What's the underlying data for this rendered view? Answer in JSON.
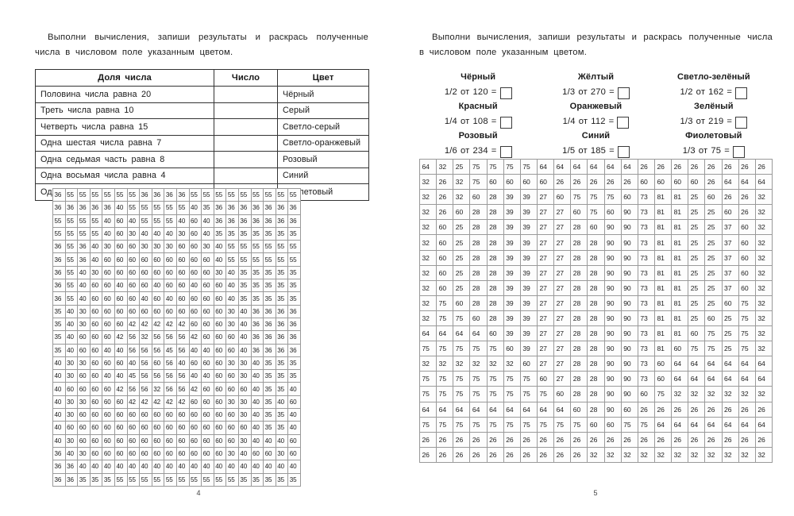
{
  "spread": {
    "left_page": {
      "page_number": "4",
      "instruction_line1": "Выполни вычисления, запиши результаты и раскрась полученные числа",
      "instruction_line2": "в числовом поле указанным цветом.",
      "table": {
        "headers": [
          "Доля числа",
          "Число",
          "Цвет"
        ],
        "rows": [
          {
            "dolya": "Половина числа равна 20",
            "chislo": "",
            "cvet": "Чёрный"
          },
          {
            "dolya": "Треть числа равна 10",
            "chislo": "",
            "cvet": "Серый"
          },
          {
            "dolya": "Четверть числа равна 15",
            "chislo": "",
            "cvet": "Светло-серый"
          },
          {
            "dolya": "Одна шестая числа равна 7",
            "chislo": "",
            "cvet": "Светло-оранжевый"
          },
          {
            "dolya": "Одна седьмая часть равна 8",
            "chislo": "",
            "cvet": "Розовый"
          },
          {
            "dolya": "Одна восьмая числа равна 4",
            "chislo": "",
            "cvet": "Синий"
          },
          {
            "dolya": "Одна пятая числа равна 9",
            "chislo": "",
            "cvet": "Фиолетовый"
          }
        ]
      },
      "number_grid": {
        "columns": 20,
        "rows": [
          [
            36,
            55,
            55,
            55,
            55,
            55,
            55,
            36,
            36,
            36,
            36,
            55,
            55,
            55,
            55,
            55,
            55,
            55,
            55,
            55
          ],
          [
            36,
            36,
            36,
            36,
            36,
            40,
            55,
            55,
            55,
            55,
            55,
            40,
            35,
            36,
            36,
            36,
            36,
            36,
            36,
            36
          ],
          [
            55,
            55,
            55,
            55,
            40,
            60,
            40,
            55,
            55,
            55,
            40,
            60,
            40,
            36,
            36,
            36,
            36,
            36,
            36,
            36
          ],
          [
            55,
            55,
            55,
            55,
            40,
            60,
            30,
            40,
            40,
            40,
            30,
            60,
            40,
            35,
            35,
            35,
            35,
            35,
            35,
            35
          ],
          [
            36,
            55,
            36,
            40,
            30,
            60,
            60,
            30,
            30,
            30,
            60,
            60,
            30,
            40,
            55,
            55,
            55,
            55,
            55,
            55
          ],
          [
            36,
            55,
            36,
            40,
            60,
            60,
            60,
            60,
            60,
            60,
            60,
            60,
            60,
            40,
            55,
            55,
            55,
            55,
            55,
            55
          ],
          [
            36,
            55,
            40,
            30,
            60,
            60,
            60,
            60,
            60,
            60,
            60,
            60,
            60,
            30,
            40,
            35,
            35,
            35,
            35,
            35
          ],
          [
            36,
            55,
            40,
            60,
            60,
            40,
            60,
            60,
            40,
            60,
            60,
            40,
            60,
            60,
            40,
            35,
            35,
            35,
            35,
            35
          ],
          [
            36,
            55,
            40,
            60,
            60,
            60,
            60,
            40,
            60,
            40,
            60,
            60,
            60,
            60,
            40,
            35,
            35,
            35,
            35,
            35
          ],
          [
            35,
            40,
            30,
            60,
            60,
            60,
            60,
            60,
            60,
            60,
            60,
            60,
            60,
            60,
            30,
            40,
            36,
            36,
            36,
            36
          ],
          [
            35,
            40,
            30,
            60,
            60,
            60,
            42,
            42,
            42,
            42,
            42,
            60,
            60,
            60,
            30,
            40,
            36,
            36,
            36,
            36
          ],
          [
            35,
            40,
            60,
            60,
            60,
            42,
            56,
            32,
            56,
            56,
            56,
            42,
            60,
            60,
            60,
            40,
            36,
            36,
            36,
            36
          ],
          [
            35,
            40,
            60,
            60,
            40,
            40,
            56,
            56,
            56,
            45,
            56,
            40,
            40,
            60,
            60,
            40,
            36,
            36,
            36,
            36
          ],
          [
            40,
            30,
            30,
            60,
            60,
            60,
            40,
            56,
            60,
            56,
            40,
            60,
            60,
            60,
            30,
            30,
            40,
            35,
            35,
            35
          ],
          [
            40,
            30,
            60,
            60,
            40,
            40,
            45,
            56,
            56,
            56,
            56,
            40,
            40,
            60,
            60,
            30,
            40,
            35,
            35,
            35
          ],
          [
            40,
            60,
            60,
            60,
            60,
            42,
            56,
            56,
            32,
            56,
            56,
            42,
            60,
            60,
            60,
            60,
            40,
            35,
            35,
            40
          ],
          [
            40,
            30,
            30,
            60,
            60,
            60,
            42,
            42,
            42,
            42,
            42,
            60,
            60,
            60,
            30,
            30,
            40,
            35,
            40,
            60
          ],
          [
            40,
            30,
            60,
            60,
            60,
            60,
            60,
            60,
            60,
            60,
            60,
            60,
            60,
            60,
            60,
            30,
            40,
            35,
            35,
            40
          ],
          [
            40,
            60,
            60,
            60,
            60,
            60,
            60,
            60,
            60,
            60,
            60,
            60,
            60,
            60,
            60,
            60,
            40,
            35,
            35,
            40
          ],
          [
            40,
            30,
            60,
            60,
            60,
            60,
            60,
            60,
            60,
            60,
            60,
            60,
            60,
            60,
            60,
            30,
            40,
            40,
            40,
            60
          ],
          [
            36,
            40,
            30,
            60,
            60,
            60,
            60,
            60,
            60,
            60,
            60,
            60,
            60,
            60,
            30,
            40,
            60,
            60,
            30,
            60
          ],
          [
            36,
            36,
            40,
            40,
            40,
            40,
            40,
            40,
            40,
            40,
            40,
            40,
            40,
            40,
            40,
            40,
            40,
            40,
            40,
            40
          ],
          [
            36,
            36,
            35,
            35,
            35,
            55,
            55,
            55,
            55,
            55,
            55,
            55,
            55,
            55,
            55,
            35,
            35,
            35,
            35,
            35
          ]
        ]
      }
    },
    "right_page": {
      "page_number": "5",
      "instruction_line1": "Выполни вычисления, запиши результаты и раскрась полученные числа",
      "instruction_line2": "в числовом поле указанным цветом.",
      "exercises": [
        [
          {
            "color": "Чёрный",
            "fraction": "1/2",
            "of": "от",
            "number": "120",
            "equals": "=",
            "answer": ""
          },
          {
            "color": "Жёлтый",
            "fraction": "1/3",
            "of": "от",
            "number": "270",
            "equals": "=",
            "answer": ""
          },
          {
            "color": "Светло-зелёный",
            "fraction": "1/2",
            "of": "от",
            "number": "162",
            "equals": "=",
            "answer": ""
          }
        ],
        [
          {
            "color": "Красный",
            "fraction": "1/4",
            "of": "от",
            "number": "108",
            "equals": "=",
            "answer": ""
          },
          {
            "color": "Оранжевый",
            "fraction": "1/4",
            "of": "от",
            "number": "112",
            "equals": "=",
            "answer": ""
          },
          {
            "color": "Зелёный",
            "fraction": "1/3",
            "of": "от",
            "number": "219",
            "equals": "=",
            "answer": ""
          }
        ],
        [
          {
            "color": "Розовый",
            "fraction": "1/6",
            "of": "от",
            "number": "234",
            "equals": "=",
            "answer": ""
          },
          {
            "color": "Синий",
            "fraction": "1/5",
            "of": "от",
            "number": "185",
            "equals": "=",
            "answer": ""
          },
          {
            "color": "Фиолетовый",
            "fraction": "1/3",
            "of": "от",
            "number": "75",
            "equals": "=",
            "answer": ""
          }
        ]
      ],
      "number_grid": {
        "columns": 21,
        "rows": [
          [
            64,
            32,
            25,
            75,
            75,
            75,
            75,
            64,
            64,
            64,
            64,
            64,
            64,
            26,
            26,
            26,
            26,
            26,
            26,
            26,
            26
          ],
          [
            32,
            26,
            32,
            75,
            60,
            60,
            60,
            60,
            26,
            26,
            26,
            26,
            26,
            60,
            60,
            60,
            60,
            26,
            64,
            64,
            64
          ],
          [
            32,
            26,
            32,
            60,
            28,
            39,
            39,
            27,
            60,
            75,
            75,
            75,
            60,
            73,
            81,
            81,
            25,
            60,
            26,
            26,
            32
          ],
          [
            32,
            26,
            60,
            28,
            28,
            39,
            39,
            27,
            27,
            60,
            75,
            60,
            90,
            73,
            81,
            81,
            25,
            25,
            60,
            26,
            32
          ],
          [
            32,
            60,
            25,
            28,
            28,
            39,
            39,
            27,
            27,
            28,
            60,
            90,
            90,
            73,
            81,
            81,
            25,
            25,
            37,
            60,
            32
          ],
          [
            32,
            60,
            25,
            28,
            28,
            39,
            39,
            27,
            27,
            28,
            28,
            90,
            90,
            73,
            81,
            81,
            25,
            25,
            37,
            60,
            32
          ],
          [
            32,
            60,
            25,
            28,
            28,
            39,
            39,
            27,
            27,
            28,
            28,
            90,
            90,
            73,
            81,
            81,
            25,
            25,
            37,
            60,
            32
          ],
          [
            32,
            60,
            25,
            28,
            28,
            39,
            39,
            27,
            27,
            28,
            28,
            90,
            90,
            73,
            81,
            81,
            25,
            25,
            37,
            60,
            32
          ],
          [
            32,
            60,
            25,
            28,
            28,
            39,
            39,
            27,
            27,
            28,
            28,
            90,
            90,
            73,
            81,
            81,
            25,
            25,
            37,
            60,
            32
          ],
          [
            32,
            75,
            60,
            28,
            28,
            39,
            39,
            27,
            27,
            28,
            28,
            90,
            90,
            73,
            81,
            81,
            25,
            25,
            60,
            75,
            32
          ],
          [
            32,
            75,
            75,
            60,
            28,
            39,
            39,
            27,
            27,
            28,
            28,
            90,
            90,
            73,
            81,
            81,
            25,
            60,
            25,
            75,
            32
          ],
          [
            64,
            64,
            64,
            64,
            60,
            39,
            39,
            27,
            27,
            28,
            28,
            90,
            90,
            73,
            81,
            81,
            60,
            75,
            25,
            75,
            32
          ],
          [
            75,
            75,
            75,
            75,
            75,
            60,
            39,
            27,
            27,
            28,
            28,
            90,
            90,
            73,
            81,
            60,
            75,
            75,
            25,
            75,
            32
          ],
          [
            32,
            32,
            32,
            32,
            32,
            32,
            60,
            27,
            27,
            28,
            28,
            90,
            90,
            73,
            60,
            64,
            64,
            64,
            64,
            64,
            64
          ],
          [
            75,
            75,
            75,
            75,
            75,
            75,
            75,
            60,
            27,
            28,
            28,
            90,
            90,
            73,
            60,
            64,
            64,
            64,
            64,
            64,
            64
          ],
          [
            75,
            75,
            75,
            75,
            75,
            75,
            75,
            75,
            60,
            28,
            28,
            90,
            90,
            60,
            75,
            32,
            32,
            32,
            32,
            32,
            32
          ],
          [
            64,
            64,
            64,
            64,
            64,
            64,
            64,
            64,
            64,
            60,
            28,
            90,
            60,
            26,
            26,
            26,
            26,
            26,
            26,
            26,
            26
          ],
          [
            75,
            75,
            75,
            75,
            75,
            75,
            75,
            75,
            75,
            75,
            60,
            60,
            75,
            75,
            64,
            64,
            64,
            64,
            64,
            64,
            64
          ],
          [
            26,
            26,
            26,
            26,
            26,
            26,
            26,
            26,
            26,
            26,
            26,
            26,
            26,
            26,
            26,
            26,
            26,
            26,
            26,
            26,
            26
          ],
          [
            26,
            26,
            26,
            26,
            26,
            26,
            26,
            26,
            26,
            26,
            32,
            32,
            32,
            32,
            32,
            32,
            32,
            32,
            32,
            32,
            32
          ]
        ]
      }
    }
  }
}
